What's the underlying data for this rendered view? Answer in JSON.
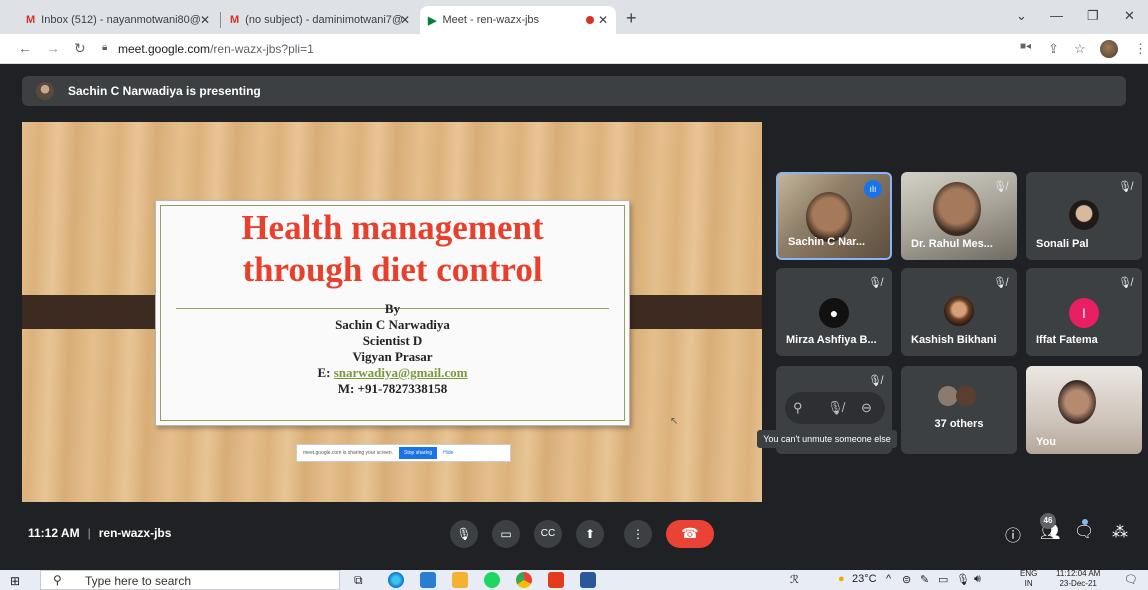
{
  "browser": {
    "tabs": [
      {
        "label": "Inbox (512) - nayanmotwani80@",
        "favicon": "M"
      },
      {
        "label": "(no subject) - daminimotwani7@",
        "favicon": "M"
      },
      {
        "label": "Meet - ren-wazx-jbs",
        "favicon": "▶"
      }
    ],
    "new_tab": "+",
    "url_host": "meet.google.com",
    "url_path": "/ren-wazx-jbs?pli=1"
  },
  "meet": {
    "presenting_banner": "Sachin C Narwadiya is presenting",
    "slide": {
      "title_line1": "Health management",
      "title_line2": "through diet control",
      "by": "By",
      "author": "Sachin C Narwadiya",
      "position": "Scientist D",
      "org": "Vigyan Prasar",
      "email_prefix": "E: ",
      "email": "snarwadiya@gmail.com",
      "mobile": "M: +91-7827338158"
    },
    "share_bar": {
      "text": "meet.google.com is sharing your screen.",
      "stop": "Stop sharing",
      "hide": "Hide"
    },
    "participants": [
      {
        "name": "Sachin C Nar...",
        "speaking": true
      },
      {
        "name": "Dr. Rahul Mes...",
        "muted": true
      },
      {
        "name": "Sonali Pal",
        "muted": true
      },
      {
        "name": "Mirza Ashfiya B...",
        "muted": true
      },
      {
        "name": "Kashish Bikhani",
        "muted": true
      },
      {
        "name": "Iffat Fatema",
        "muted": true,
        "initial": "I"
      },
      {
        "name": "",
        "muted": true
      },
      {
        "name": "37 others"
      },
      {
        "name": "You"
      }
    ],
    "tooltip": "You can't unmute someone else",
    "time": "11:12 AM",
    "meeting_code": "ren-wazx-jbs",
    "people_count": "46"
  },
  "taskbar": {
    "search_placeholder": "Type here to search",
    "weather": "23°C",
    "lang_line1": "ENG",
    "lang_line2": "IN",
    "time": "11:12:04 AM",
    "date": "23-Dec-21"
  },
  "colors": {
    "meet_bg": "#202124",
    "tile_bg": "#3c4043",
    "end_call": "#ea4335",
    "accent": "#1a73e8",
    "slide_title": "#e8402c"
  }
}
